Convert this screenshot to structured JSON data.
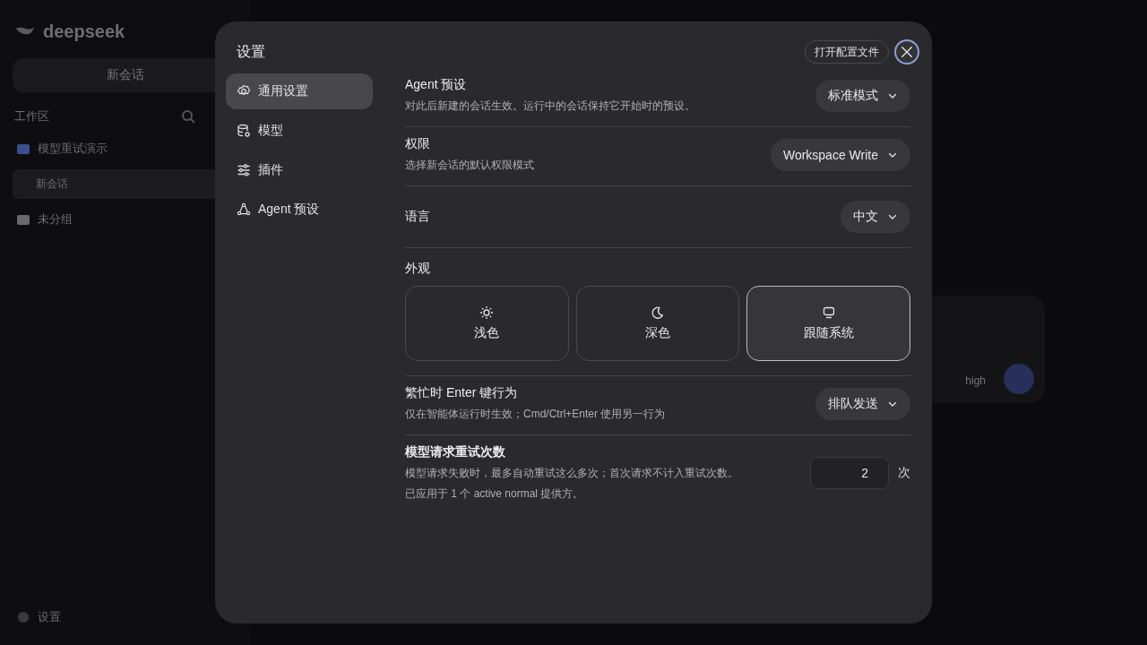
{
  "background": {
    "brand": "deepseek",
    "new_chat": "新会话",
    "workspace_label": "工作区",
    "groups": [
      {
        "name": "模型重试演示",
        "color": "#3b4f8f",
        "children": [
          {
            "name": "新会话",
            "selected": true
          }
        ]
      },
      {
        "name": "未分组",
        "color": "#6a6a6e"
      }
    ],
    "settings": "设置",
    "composer": {
      "effort": "high"
    }
  },
  "dialog": {
    "title": "设置",
    "open_config": "打开配置文件",
    "nav": [
      {
        "label": "通用设置",
        "selected": true
      },
      {
        "label": "模型",
        "selected": false
      },
      {
        "label": "插件",
        "selected": false
      },
      {
        "label": "Agent 预设",
        "selected": false
      }
    ],
    "settings": [
      {
        "kind": "select",
        "title": "Agent 预设",
        "description": "对此后新建的会话生效。运行中的会话保持它开始时的预设。",
        "value": "标准模式"
      },
      {
        "kind": "select",
        "title": "权限",
        "description": "选择新会话的默认权限模式",
        "value": "Workspace Write"
      },
      {
        "kind": "select",
        "title": "语言",
        "value": "中文"
      },
      {
        "kind": "theme",
        "title": "外观",
        "options": [
          {
            "label": "浅色",
            "selected": false
          },
          {
            "label": "深色",
            "selected": false
          },
          {
            "label": "跟随系统",
            "selected": true
          }
        ]
      },
      {
        "kind": "select",
        "title": "繁忙时 Enter 键行为",
        "description": "仅在智能体运行时生效；Cmd/Ctrl+Enter 使用另一行为",
        "value": "排队发送"
      },
      {
        "kind": "number",
        "title": "模型请求重试次数",
        "description": "模型请求失败时，最多自动重试这么多次；首次请求不计入重试次数。",
        "note": "已应用于 1 个 active normal 提供方。",
        "value": "2",
        "unit": "次"
      }
    ]
  }
}
